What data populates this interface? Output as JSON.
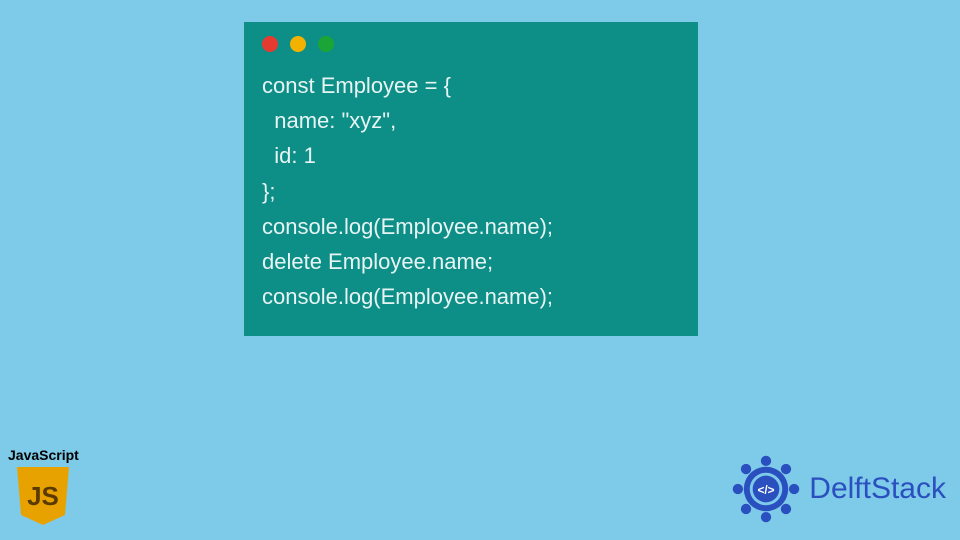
{
  "code_window": {
    "traffic_lights": [
      "red",
      "yellow",
      "green"
    ],
    "lines": [
      "const Employee = {",
      "  name: \"xyz\",",
      "  id: 1",
      "};",
      "console.log(Employee.name);",
      "delete Employee.name;",
      "console.log(Employee.name);"
    ]
  },
  "js_badge": {
    "label": "JavaScript",
    "shield_text": "JS",
    "bg_color": "#e8a200",
    "text_color": "#5b3a00"
  },
  "brand": {
    "name": "DelftStack",
    "logo_color": "#2a4fbf",
    "logo_glyph": "</>"
  }
}
